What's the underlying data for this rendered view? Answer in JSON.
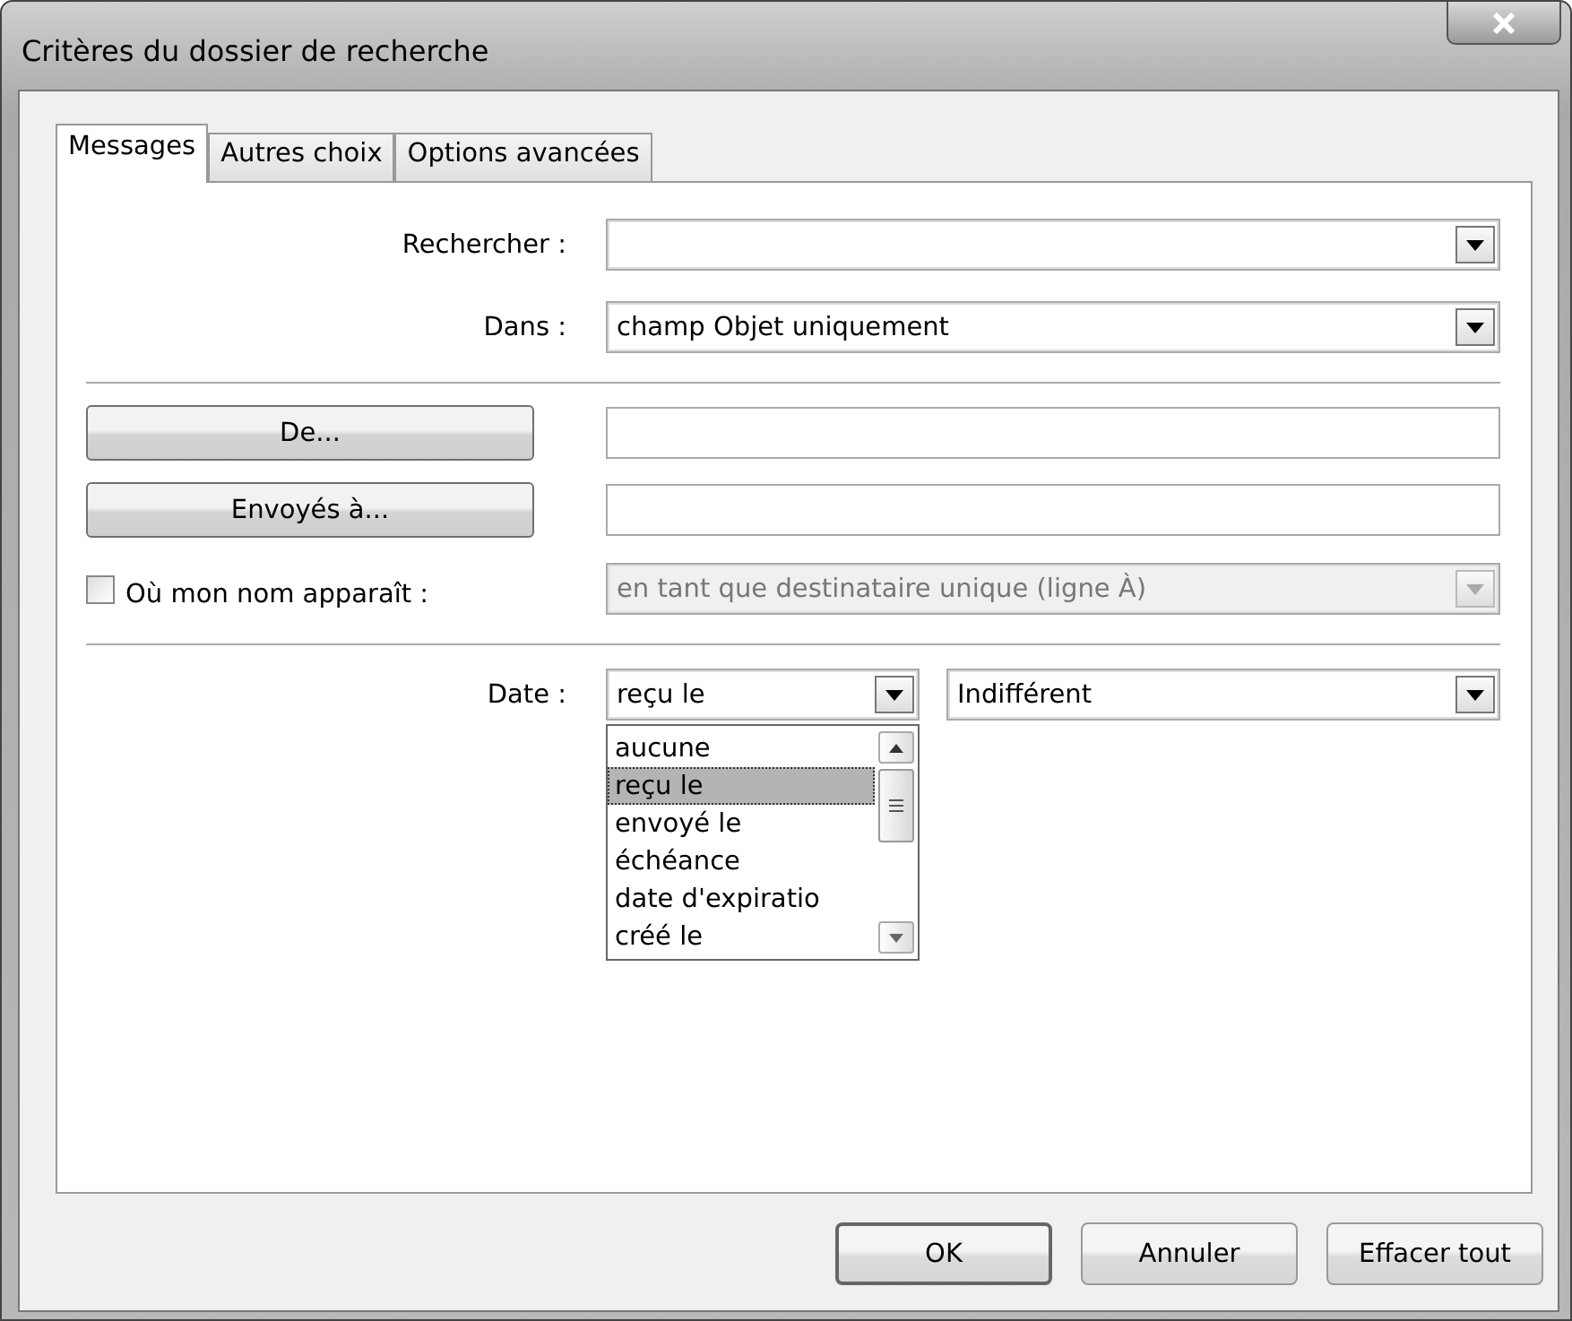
{
  "window": {
    "title": "Critères du dossier de recherche"
  },
  "tabs": [
    {
      "label": "Messages",
      "selected": true
    },
    {
      "label": "Autres choix",
      "selected": false
    },
    {
      "label": "Options avancées",
      "selected": false
    }
  ],
  "search_for": {
    "label": "Rechercher :"
  },
  "search_in": {
    "label": "Dans :",
    "value": "champ Objet uniquement"
  },
  "from_button": "De...",
  "sent_to_button": "Envoyés à...",
  "my_name": {
    "label": "Où mon nom apparaît :",
    "checked": false,
    "disabled": true,
    "value": "en tant que destinataire unique (ligne À)"
  },
  "date": {
    "label": "Date :",
    "value": "reçu le",
    "expanded": true,
    "options": [
      {
        "label": "aucune",
        "selected": false
      },
      {
        "label": "reçu le",
        "selected": true
      },
      {
        "label": "envoyé le",
        "selected": false
      },
      {
        "label": "échéance",
        "selected": false
      },
      {
        "label": "date d'expiratio",
        "selected": false
      },
      {
        "label": "créé le",
        "selected": false
      }
    ],
    "range": "Indifférent"
  },
  "buttons": [
    {
      "label": "OK",
      "default": true
    },
    {
      "label": "Annuler",
      "default": false
    },
    {
      "label": "Effacer tout",
      "default": false
    }
  ]
}
